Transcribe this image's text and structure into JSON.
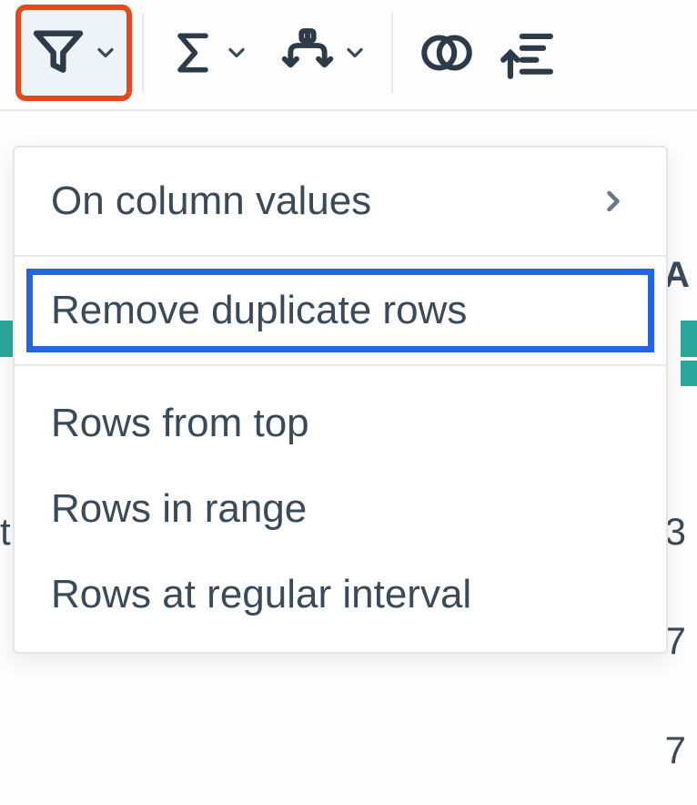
{
  "toolbar": {
    "filter": {
      "name": "filter-button"
    },
    "aggregate": {
      "name": "aggregate-button"
    },
    "pivot": {
      "name": "pivot-button"
    },
    "join": {
      "name": "join-button"
    },
    "sort": {
      "name": "sort-button"
    }
  },
  "menu": {
    "items": [
      {
        "label": "On column values",
        "has_submenu": true
      },
      {
        "label": "Remove duplicate rows",
        "highlighted": true
      },
      {
        "label": "Rows from top"
      },
      {
        "label": "Rows in range"
      },
      {
        "label": "Rows at regular interval"
      }
    ]
  },
  "background": {
    "column_header": "A",
    "row_label_left": "t",
    "cell_right_0": "3",
    "cell_right_1": "7",
    "cell_right_2": "7"
  }
}
